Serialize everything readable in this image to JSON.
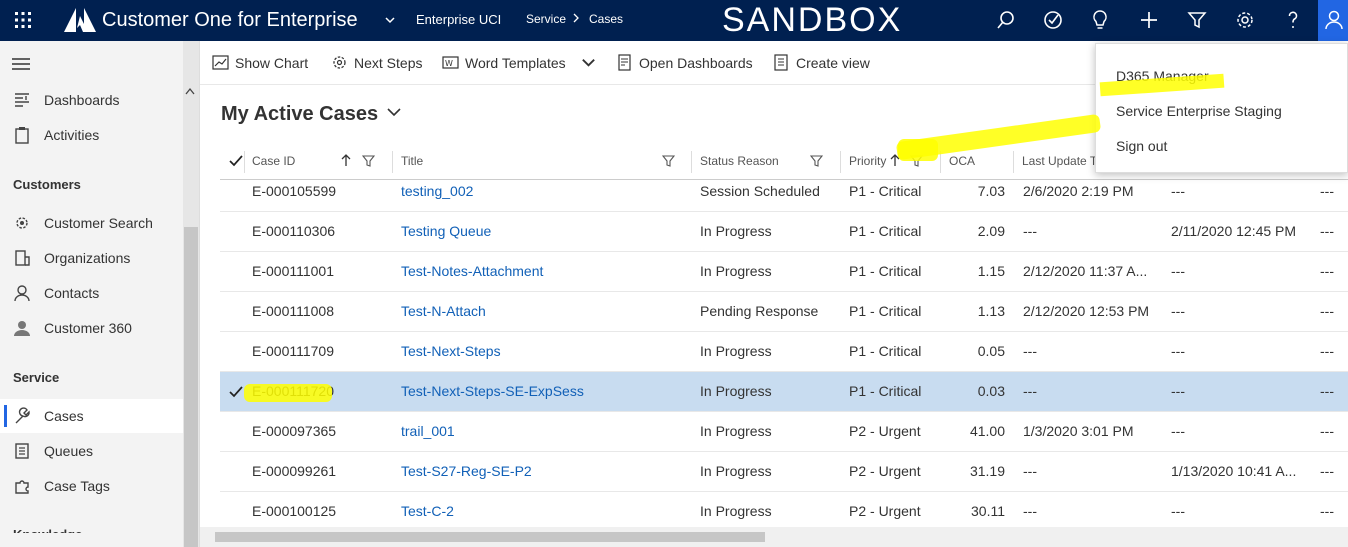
{
  "topbar": {
    "app_title": "Customer One for Enterprise",
    "app_name": "Enterprise UCI",
    "breadcrumb": [
      "Service",
      "Cases"
    ],
    "banner": "SANDBOX",
    "icons": [
      "search-icon",
      "task-icon",
      "lightbulb-icon",
      "plus-icon",
      "filter-icon",
      "settings-icon",
      "help-icon",
      "user-icon"
    ]
  },
  "command_bar": {
    "show_chart": "Show Chart",
    "next_steps": "Next Steps",
    "word_templates": "Word Templates",
    "open_dashboards": "Open Dashboards",
    "create_view": "Create view"
  },
  "sidebar": {
    "items_top": [
      {
        "label": "Dashboards",
        "icon": "dashboard-icon"
      },
      {
        "label": "Activities",
        "icon": "clipboard-icon"
      }
    ],
    "groups": [
      {
        "title": "Customers",
        "items": [
          {
            "label": "Customer Search",
            "icon": "gear-search-icon"
          },
          {
            "label": "Organizations",
            "icon": "organization-icon"
          },
          {
            "label": "Contacts",
            "icon": "person-icon"
          },
          {
            "label": "Customer 360",
            "icon": "customer-icon"
          }
        ]
      },
      {
        "title": "Service",
        "items": [
          {
            "label": "Cases",
            "icon": "wrench-icon",
            "active": true
          },
          {
            "label": "Queues",
            "icon": "queue-icon"
          },
          {
            "label": "Case Tags",
            "icon": "puzzle-icon"
          }
        ]
      }
    ],
    "next_group_partial": "Knowledge"
  },
  "view": {
    "title": "My Active Cases"
  },
  "grid": {
    "columns": [
      "Case ID",
      "Title",
      "Status Reason",
      "Priority",
      "OCA",
      "Last Update To"
    ],
    "rows": [
      {
        "case_id": "E-000105599",
        "title": "testing_002",
        "status": "Session Scheduled",
        "priority": "P1 - Critical",
        "oca": "7.03",
        "last_update": "2/6/2020 2:19 PM",
        "col7": "---",
        "col8": "---"
      },
      {
        "case_id": "E-000110306",
        "title": "Testing Queue",
        "status": "In Progress",
        "priority": "P1 - Critical",
        "oca": "2.09",
        "last_update": "---",
        "col7": "2/11/2020 12:45 PM",
        "col8": "---"
      },
      {
        "case_id": "E-000111001",
        "title": "Test-Notes-Attachment",
        "status": "In Progress",
        "priority": "P1 - Critical",
        "oca": "1.15",
        "last_update": "2/12/2020 11:37 A...",
        "col7": "---",
        "col8": "---"
      },
      {
        "case_id": "E-000111008",
        "title": "Test-N-Attach",
        "status": "Pending Response",
        "priority": "P1 - Critical",
        "oca": "1.13",
        "last_update": "2/12/2020 12:53 PM",
        "col7": "---",
        "col8": "---"
      },
      {
        "case_id": "E-000111709",
        "title": "Test-Next-Steps",
        "status": "In Progress",
        "priority": "P1 - Critical",
        "oca": "0.05",
        "last_update": "---",
        "col7": "---",
        "col8": "---"
      },
      {
        "case_id": "E-000111720",
        "title": "Test-Next-Steps-SE-ExpSess",
        "status": "In Progress",
        "priority": "P1 - Critical",
        "oca": "0.03",
        "last_update": "---",
        "col7": "---",
        "col8": "---",
        "selected": true
      },
      {
        "case_id": "E-000097365",
        "title": "trail_001",
        "status": "In Progress",
        "priority": "P2 - Urgent",
        "oca": "41.00",
        "last_update": "1/3/2020 3:01 PM",
        "col7": "---",
        "col8": "---"
      },
      {
        "case_id": "E-000099261",
        "title": "Test-S27-Reg-SE-P2",
        "status": "In Progress",
        "priority": "P2 - Urgent",
        "oca": "31.19",
        "last_update": "---",
        "col7": "1/13/2020 10:41 A...",
        "col8": "---"
      },
      {
        "case_id": "E-000100125",
        "title": "Test-C-2",
        "status": "In Progress",
        "priority": "P2 - Urgent",
        "oca": "30.11",
        "last_update": "---",
        "col7": "---",
        "col8": "---"
      }
    ]
  },
  "user_menu": {
    "items": [
      "D365 Manager",
      "Service Enterprise Staging",
      "Sign out"
    ]
  },
  "colors": {
    "topbar": "#002050",
    "accent": "#2266e3",
    "link": "#1160b7",
    "selected_row": "#c8dcf0",
    "highlight": "#ffff00"
  }
}
